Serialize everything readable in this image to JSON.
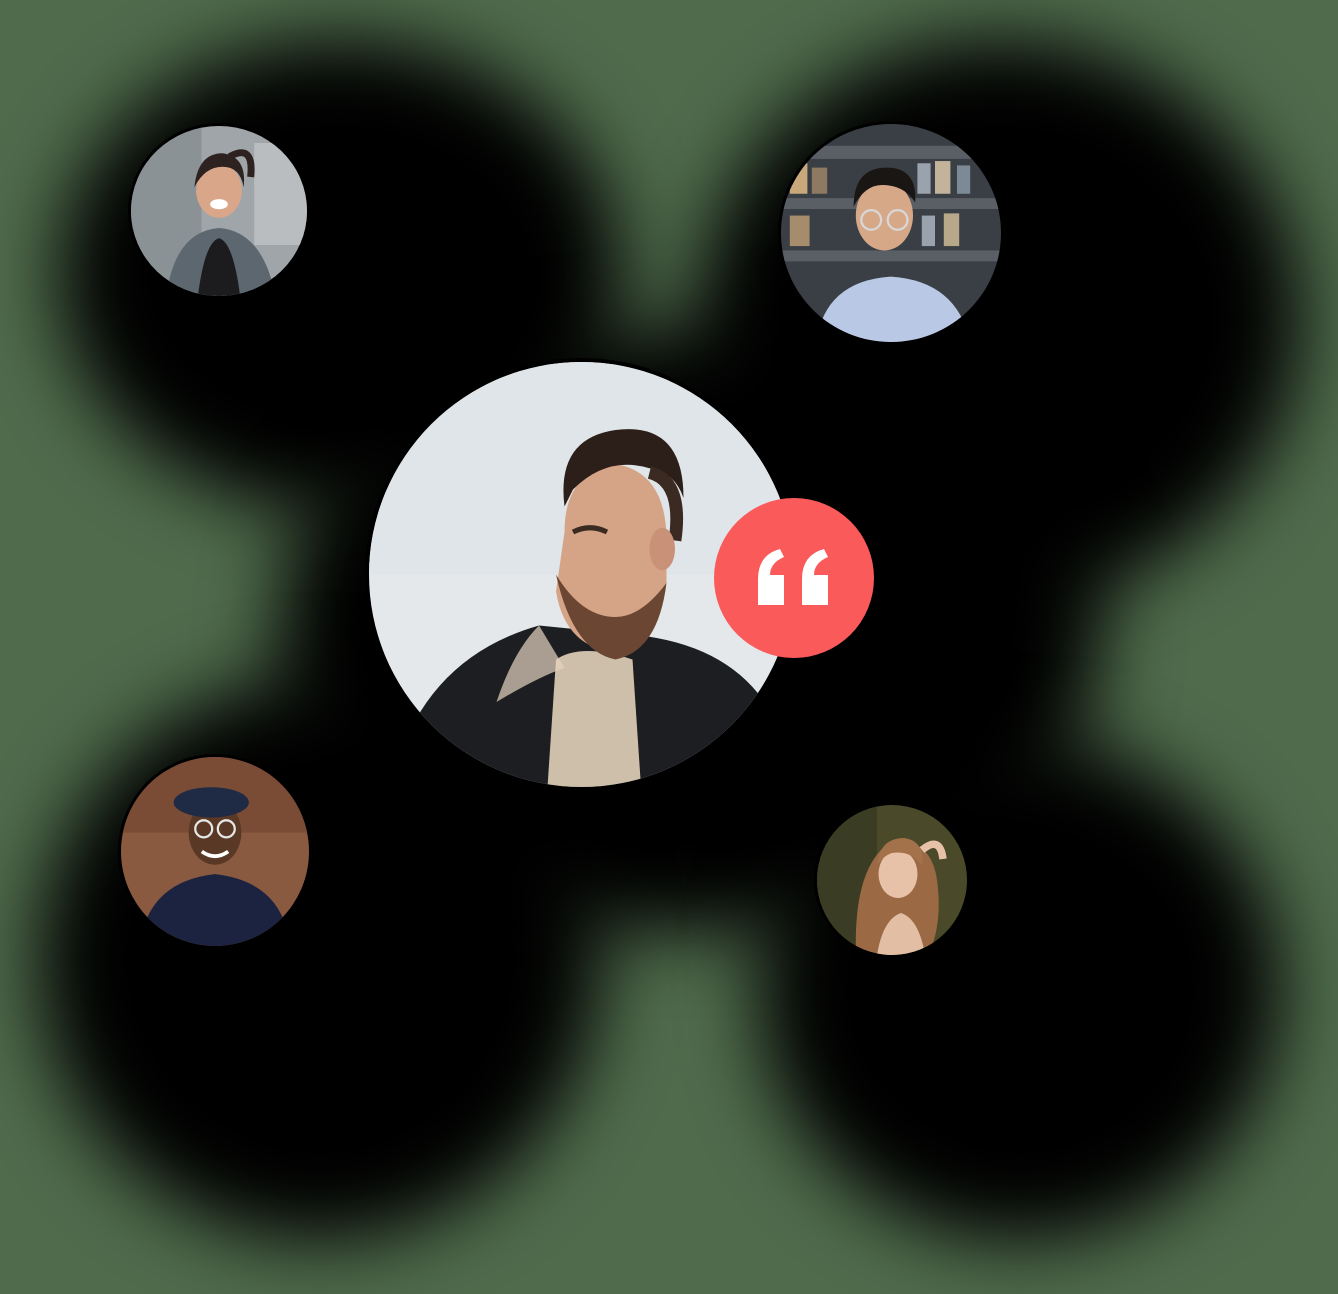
{
  "colors": {
    "backdrop": "#4f6b4c",
    "shadow": "#000000",
    "accent": "#fa5a5a",
    "ring": "#000000",
    "quote_mark": "#ffffff"
  },
  "avatars": [
    {
      "name": "avatar-woman-denim-jacket",
      "icon": "person-photo"
    },
    {
      "name": "avatar-man-glasses-store",
      "icon": "person-photo"
    },
    {
      "name": "avatar-man-beard-featured",
      "icon": "person-photo"
    },
    {
      "name": "avatar-man-beret-glasses",
      "icon": "person-photo"
    },
    {
      "name": "avatar-woman-long-hair",
      "icon": "person-photo"
    }
  ],
  "quote_badge": {
    "icon": "quote-icon"
  }
}
